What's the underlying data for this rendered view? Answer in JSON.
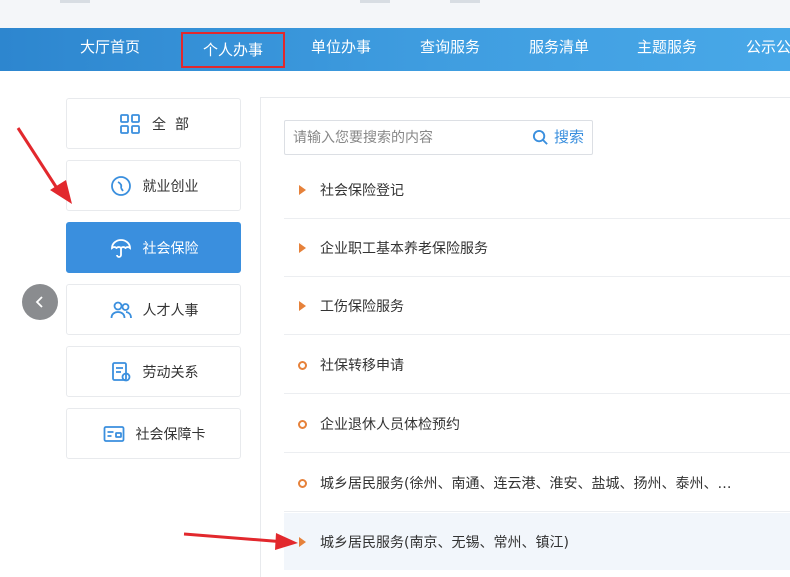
{
  "nav": {
    "items": [
      {
        "label": "大厅首页",
        "active": false
      },
      {
        "label": "个人办事",
        "active": true
      },
      {
        "label": "单位办事",
        "active": false
      },
      {
        "label": "查询服务",
        "active": false
      },
      {
        "label": "服务清单",
        "active": false
      },
      {
        "label": "主题服务",
        "active": false
      },
      {
        "label": "公示公",
        "active": false
      }
    ]
  },
  "sidebar": {
    "items": [
      {
        "label": "全  部",
        "icon": "grid-icon",
        "active": false
      },
      {
        "label": "就业创业",
        "icon": "briefcase-icon",
        "active": false
      },
      {
        "label": "社会保险",
        "icon": "umbrella-icon",
        "active": true
      },
      {
        "label": "人才人事",
        "icon": "people-icon",
        "active": false
      },
      {
        "label": "劳动关系",
        "icon": "contract-icon",
        "active": false
      },
      {
        "label": "社会保障卡",
        "icon": "card-icon",
        "active": false
      }
    ]
  },
  "search": {
    "placeholder": "请输入您要搜索的内容",
    "button_label": "搜索"
  },
  "services": [
    {
      "label": "社会保险登记",
      "bullet": "triangle"
    },
    {
      "label": "企业职工基本养老保险服务",
      "bullet": "triangle"
    },
    {
      "label": "工伤保险服务",
      "bullet": "triangle"
    },
    {
      "label": "社保转移申请",
      "bullet": "circle"
    },
    {
      "label": "企业退休人员体检预约",
      "bullet": "circle"
    },
    {
      "label": "城乡居民服务(徐州、南通、连云港、淮安、盐城、扬州、泰州、…",
      "bullet": "circle"
    },
    {
      "label": "城乡居民服务(南京、无锡、常州、镇江)",
      "bullet": "triangle"
    }
  ],
  "colors": {
    "nav_start": "#2d86cf",
    "nav_end": "#48a8e8",
    "accent_blue": "#3a8fde",
    "bullet_orange": "#e6813a",
    "highlight_red": "#e2282d"
  }
}
